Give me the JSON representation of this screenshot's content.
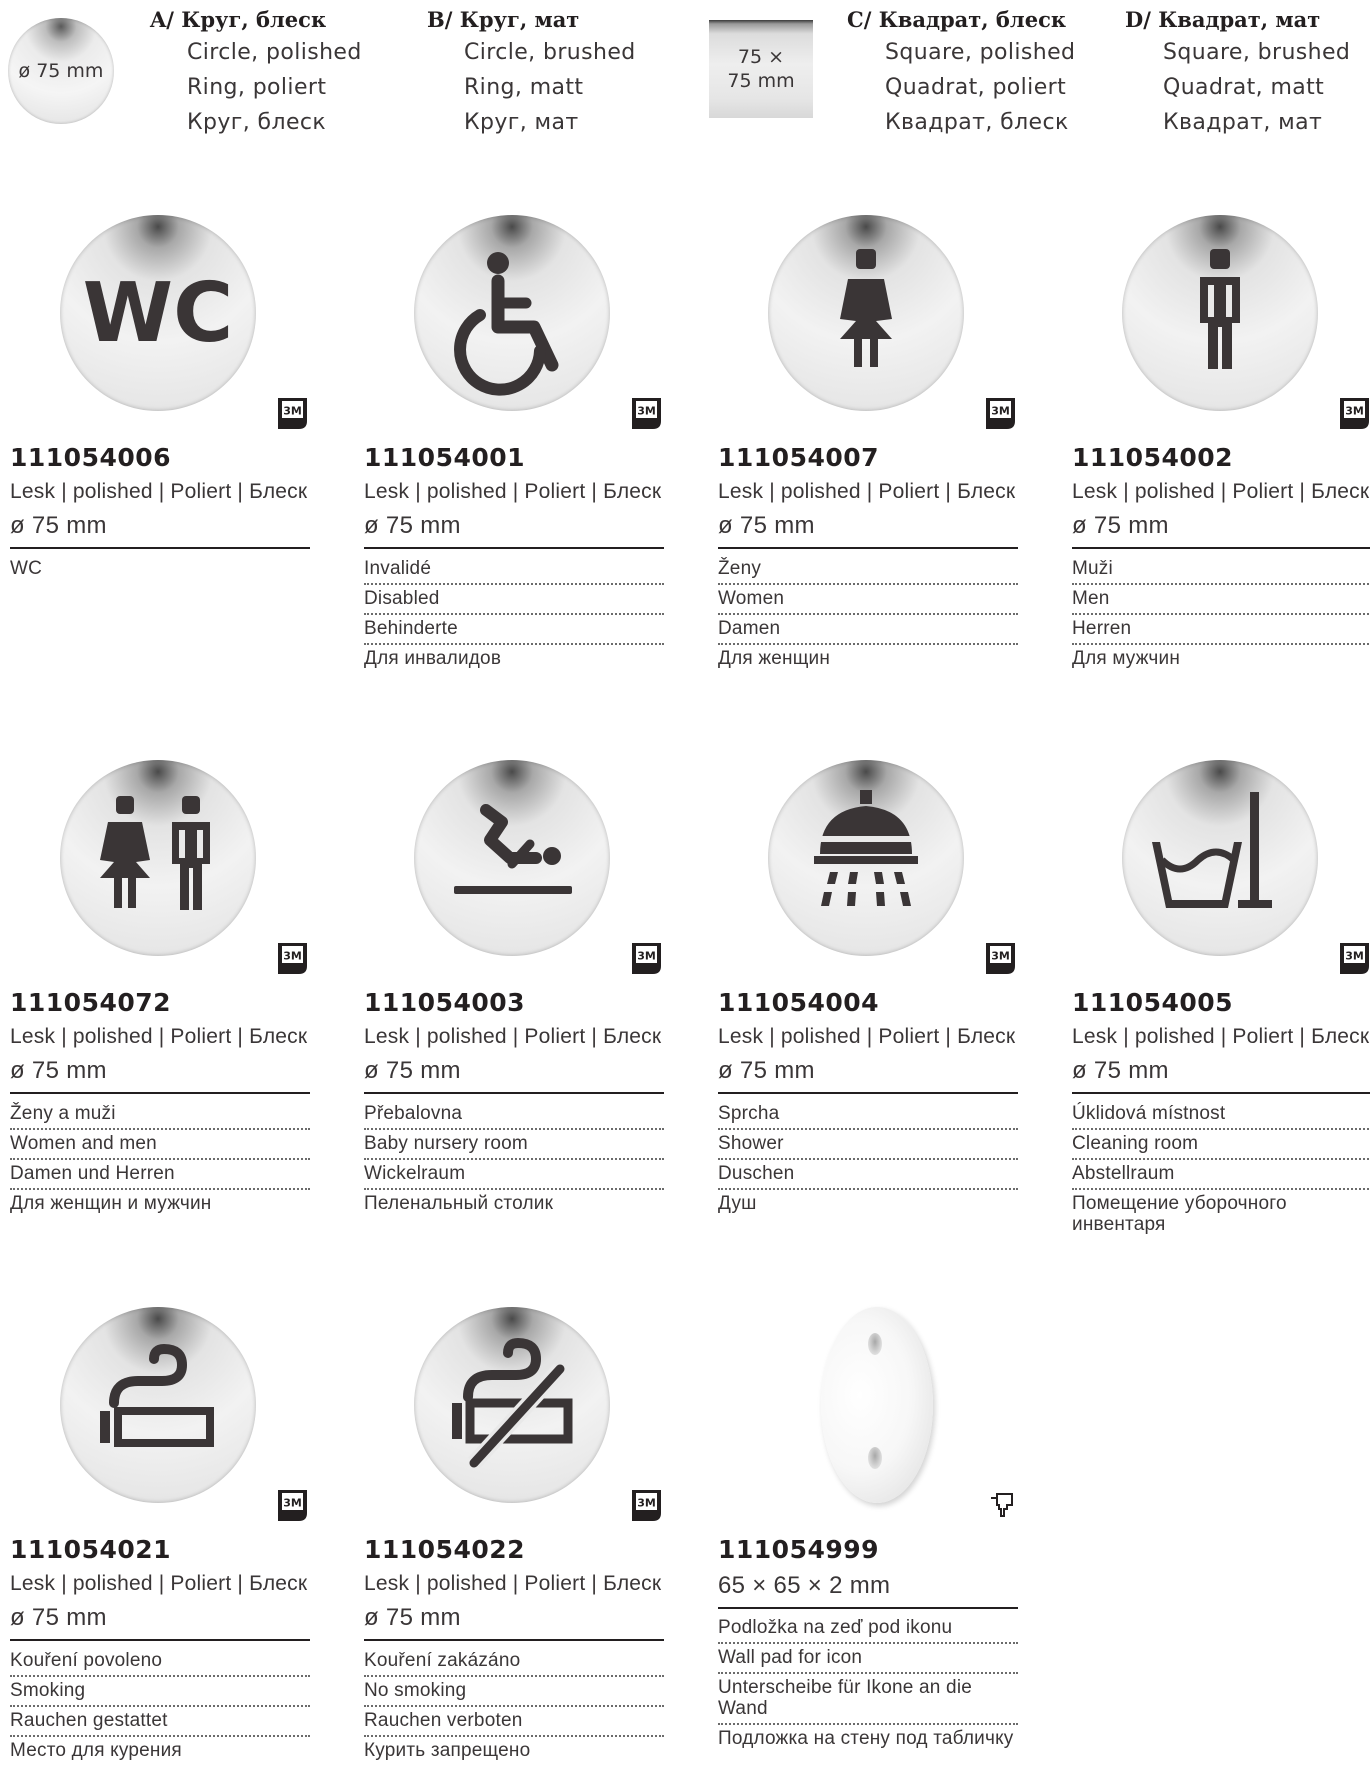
{
  "legend": {
    "swatch_circle_label": "ø 75 mm",
    "swatch_square_label": "75 × 75 mm",
    "variants": [
      {
        "title": "A/ Круг, блеск",
        "lines": [
          "Circle, polished",
          "Ring, poliert",
          "Круг, блеск"
        ]
      },
      {
        "title": "B/ Круг, мат",
        "lines": [
          "Circle, brushed",
          "Ring, matt",
          "Круг, мат"
        ]
      },
      {
        "title": "C/ Квадрат, блеск",
        "lines": [
          "Square, polished",
          "Quadrat, poliert",
          "Квадрат, блеск"
        ]
      },
      {
        "title": "D/ Квадрат, мат",
        "lines": [
          "Square, brushed",
          "Quadrat, matt",
          "Квадрат, мат"
        ]
      }
    ]
  },
  "badge_text": "3M",
  "products": [
    {
      "code": "111054006",
      "finish": "Lesk | polished | Poliert | Блеск",
      "dim": "ø 75 mm",
      "icon": "wc-icon",
      "icon_text": "WC",
      "names": [
        "WC"
      ]
    },
    {
      "code": "111054001",
      "finish": "Lesk | polished | Poliert | Блеск",
      "dim": "ø 75 mm",
      "icon": "wheelchair-icon",
      "names": [
        "Invalidé",
        "Disabled",
        "Behinderte",
        "Для инвалидов"
      ]
    },
    {
      "code": "111054007",
      "finish": "Lesk | polished | Poliert | Блеск",
      "dim": "ø 75 mm",
      "icon": "woman-icon",
      "names": [
        "Ženy",
        "Women",
        "Damen",
        "Для женщин"
      ]
    },
    {
      "code": "111054002",
      "finish": "Lesk | polished | Poliert | Блеск",
      "dim": "ø 75 mm",
      "icon": "man-icon",
      "names": [
        "Muži",
        "Men",
        "Herren",
        "Для мужчин"
      ]
    },
    {
      "code": "111054072",
      "finish": "Lesk | polished | Poliert | Блеск",
      "dim": "ø 75 mm",
      "icon": "woman-man-icon",
      "names": [
        "Ženy a muži",
        "Women and men",
        "Damen und Herren",
        "Для женщин и мужчин"
      ]
    },
    {
      "code": "111054003",
      "finish": "Lesk | polished | Poliert | Блеск",
      "dim": "ø 75 mm",
      "icon": "baby-changing-icon",
      "names": [
        "Přebalovna",
        "Baby nursery room",
        "Wickelraum",
        "Пеленальный столик"
      ]
    },
    {
      "code": "111054004",
      "finish": "Lesk | polished | Poliert | Блеск",
      "dim": "ø 75 mm",
      "icon": "shower-icon",
      "names": [
        "Sprcha",
        "Shower",
        "Duschen",
        "Душ"
      ]
    },
    {
      "code": "111054005",
      "finish": "Lesk | polished | Poliert | Блеск",
      "dim": "ø 75 mm",
      "icon": "bucket-mop-icon",
      "names": [
        "Úklidová místnost",
        "Cleaning room",
        "Abstellraum",
        "Помещение уборочного инвентаря"
      ]
    },
    {
      "code": "111054021",
      "finish": "Lesk | polished | Poliert | Блеск",
      "dim": "ø 75 mm",
      "icon": "smoking-icon",
      "names": [
        "Kouření povoleno",
        "Smoking",
        "Rauchen gestattet",
        "Место для курения"
      ]
    },
    {
      "code": "111054022",
      "finish": "Lesk | polished | Poliert | Блеск",
      "dim": "ø 75 mm",
      "icon": "no-smoking-icon",
      "names": [
        "Kouření zakázáno",
        "No smoking",
        "Rauchen verboten",
        "Курить запрещено"
      ]
    },
    {
      "code": "111054999",
      "finish": "",
      "dim": "65 × 65 × 2 mm",
      "icon": "wall-pad-image",
      "names": [
        "Podložka na zeď pod ikonu",
        "Wall pad for icon",
        "Unterscheibe für Ikone an die Wand",
        "Подложка на стену под табличку"
      ]
    }
  ],
  "colors": {
    "ink": "#231f20",
    "text": "#3a3637",
    "steel": "#e6e6e6"
  }
}
